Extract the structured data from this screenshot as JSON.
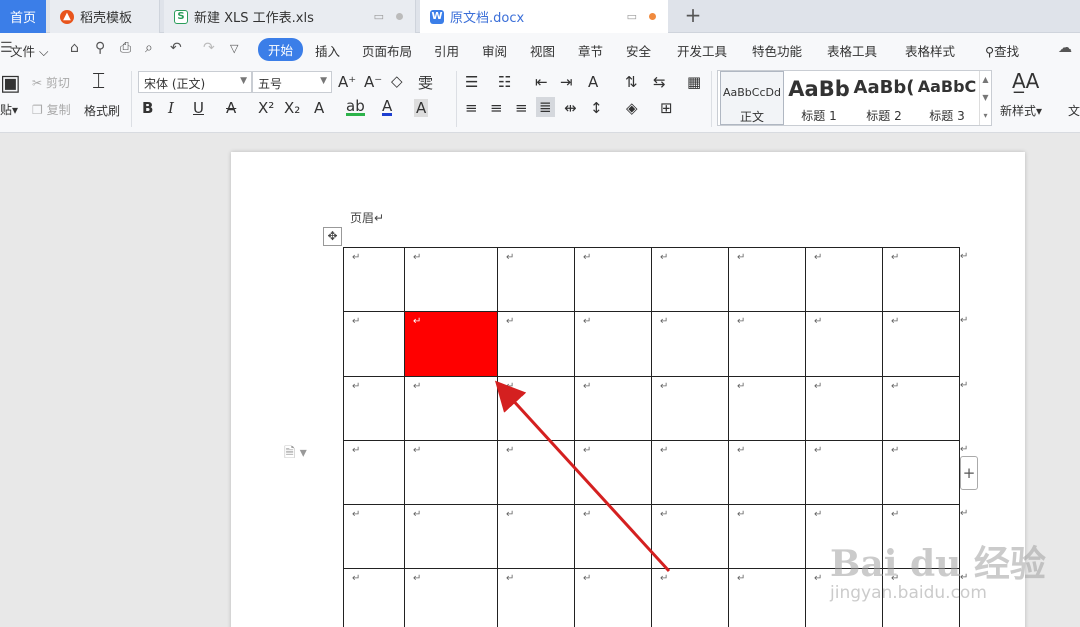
{
  "tabs": {
    "home": "首页",
    "t1": "稻壳模板",
    "t2": "新建 XLS 工作表.xls",
    "t3": "原文档.docx",
    "new_tab": "+"
  },
  "menu": {
    "file": "文件",
    "items": [
      "开始",
      "插入",
      "页面布局",
      "引用",
      "审阅",
      "视图",
      "章节",
      "安全",
      "开发工具",
      "特色功能",
      "表格工具",
      "表格样式"
    ],
    "search": "查找"
  },
  "ribbon": {
    "paste": "贴",
    "cut": "剪切",
    "copy": "复制",
    "format_painter": "格式刷",
    "font_name": "宋体 (正文)",
    "font_size": "五号",
    "styles": [
      {
        "preview": "AaBbCcDd",
        "label": "正文"
      },
      {
        "preview": "AaBb",
        "label": "标题 1"
      },
      {
        "preview": "AaBb(",
        "label": "标题 2"
      },
      {
        "preview": "AaBbC",
        "label": "标题 3"
      }
    ],
    "new_style": "新样式",
    "more": "文"
  },
  "document": {
    "header": "页眉↵",
    "paragraph_mark": "↵",
    "rows": 6,
    "cols": 8,
    "highlighted_cell": [
      1,
      1
    ]
  },
  "watermark": {
    "brand": "Bai du 经验",
    "url": "jingyan.baidu.com"
  },
  "colors": {
    "accent": "#3b7ee8",
    "highlight": "#ff0000",
    "arrow": "#d42020"
  }
}
